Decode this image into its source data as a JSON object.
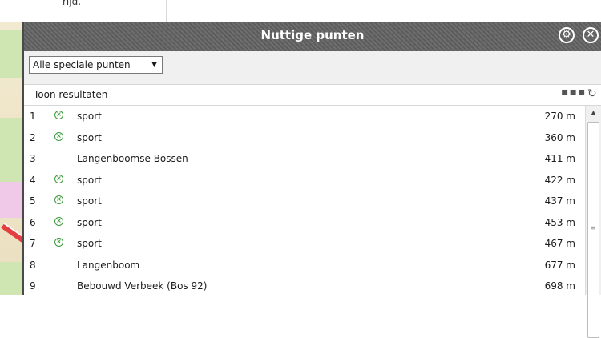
{
  "background": {
    "cut_text": "rijd."
  },
  "dialog": {
    "title": "Nuttige punten",
    "settings_icon": "gear-icon",
    "close_icon": "close-icon",
    "filter": {
      "selected": "Alle speciale punten"
    },
    "results_label": "Toon resultaten",
    "more_icon": "more-dots-icon",
    "refresh_icon": "refresh-icon",
    "rows": [
      {
        "num": "1",
        "icon": "sport",
        "name": "sport",
        "dist": "270 m"
      },
      {
        "num": "2",
        "icon": "sport",
        "name": "sport",
        "dist": "360 m"
      },
      {
        "num": "3",
        "icon": "",
        "name": "Langenboomse Bossen",
        "dist": "411 m"
      },
      {
        "num": "4",
        "icon": "sport",
        "name": "sport",
        "dist": "422 m"
      },
      {
        "num": "5",
        "icon": "sport",
        "name": "sport",
        "dist": "437 m"
      },
      {
        "num": "6",
        "icon": "sport",
        "name": "sport",
        "dist": "453 m"
      },
      {
        "num": "7",
        "icon": "sport",
        "name": "sport",
        "dist": "467 m"
      },
      {
        "num": "8",
        "icon": "",
        "name": "Langenboom",
        "dist": "677 m"
      },
      {
        "num": "9",
        "icon": "",
        "name": "Bebouwd Verbeek (Bos 92)",
        "dist": "698 m"
      }
    ]
  },
  "colors": {
    "title_bar": "#6e6e6e",
    "sport_icon": "#3c9a3c"
  }
}
